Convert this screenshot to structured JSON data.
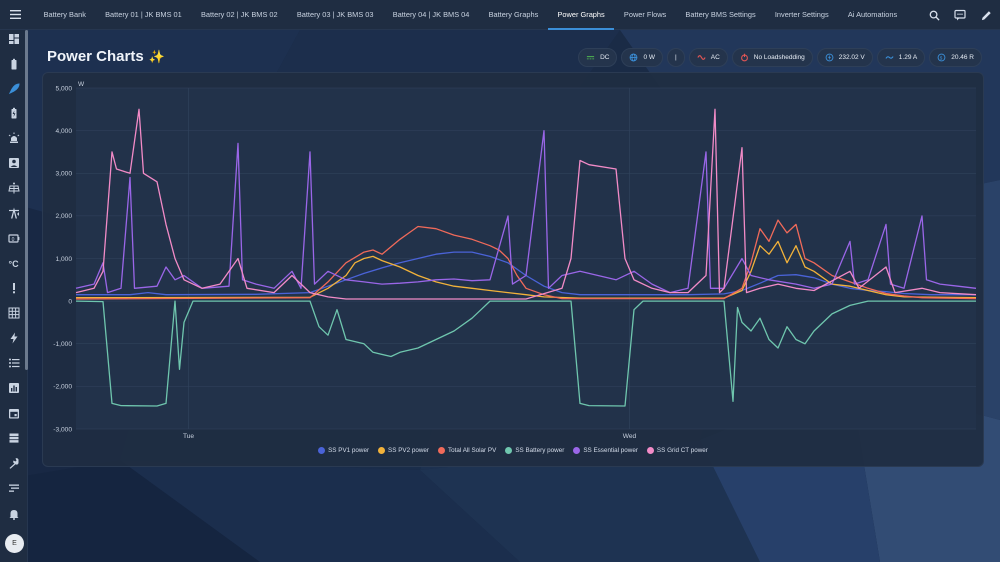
{
  "topbar": {
    "tabs": [
      {
        "label": "Battery Bank",
        "active": false
      },
      {
        "label": "Battery 01 | JK BMS 01",
        "active": false
      },
      {
        "label": "Battery 02 | JK BMS 02",
        "active": false
      },
      {
        "label": "Battery 03 | JK BMS 03",
        "active": false
      },
      {
        "label": "Battery 04 | JK BMS 04",
        "active": false
      },
      {
        "label": "Battery Graphs",
        "active": false
      },
      {
        "label": "Power Graphs",
        "active": true
      },
      {
        "label": "Power Flows",
        "active": false
      },
      {
        "label": "Battery BMS Settings",
        "active": false
      },
      {
        "label": "Inverter Settings",
        "active": false
      },
      {
        "label": "Ai Automations",
        "active": false
      }
    ],
    "icons": [
      "search-icon",
      "assist-icon",
      "edit-icon"
    ]
  },
  "sidebar": {
    "items": [
      "dashboard-icon",
      "battery-icon",
      "rocket-icon",
      "battery-charging-icon",
      "alarm-light-icon",
      "account-box-icon",
      "solar-panel-icon",
      "transmission-tower-icon",
      "battery-capacity-icon",
      "temperature-icon",
      "alert-icon",
      "grid-icon",
      "lightning-icon",
      "list-icon",
      "chart-icon",
      "calendar-icon",
      "server-icon",
      "wrench-icon",
      "settings-list-icon",
      "bell-icon"
    ],
    "active_index": 2,
    "avatar": "E"
  },
  "page": {
    "title": "Power Charts",
    "title_icon": "sparkles-icon"
  },
  "badges": [
    {
      "icon": "dc-icon",
      "label": "DC",
      "color": "#4caf50"
    },
    {
      "icon": "globe-icon",
      "label": "0 W",
      "color": "#3b8fd8"
    },
    {
      "icon": "divider",
      "label": "|",
      "color": "#e8eef6"
    },
    {
      "icon": "ac-icon",
      "label": "AC",
      "color": "#e05555"
    },
    {
      "icon": "power-plug-icon",
      "label": "No Loadshedding",
      "color": "#e05555"
    },
    {
      "icon": "voltage-icon",
      "label": "232.02 V",
      "color": "#3b8fd8"
    },
    {
      "icon": "current-icon",
      "label": "1.29 A",
      "color": "#3b8fd8"
    },
    {
      "icon": "currency-icon",
      "label": "20.46 R",
      "color": "#3b8fd8"
    }
  ],
  "chart_data": {
    "type": "line",
    "unit": "W",
    "ylim": [
      -3000,
      5000
    ],
    "yticks": [
      "5,000",
      "4,000",
      "3,000",
      "2,000",
      "1,000",
      "0",
      "-1,000",
      "-2,000",
      "-3,000"
    ],
    "xticks": [
      "Tue",
      "Wed"
    ],
    "grid": true,
    "legend_position": "bottom",
    "series": [
      {
        "name": "SS PV1 power",
        "color": "#4a63d8",
        "points": [
          [
            0,
            150
          ],
          [
            6,
            150
          ],
          [
            8,
            200
          ],
          [
            10,
            150
          ],
          [
            20,
            160
          ],
          [
            26,
            200
          ],
          [
            28,
            350
          ],
          [
            30,
            500
          ],
          [
            32,
            650
          ],
          [
            34,
            780
          ],
          [
            36,
            900
          ],
          [
            38,
            1000
          ],
          [
            40,
            1100
          ],
          [
            42,
            1150
          ],
          [
            44,
            1150
          ],
          [
            46,
            1050
          ],
          [
            48,
            900
          ],
          [
            50,
            600
          ],
          [
            52,
            350
          ],
          [
            54,
            200
          ],
          [
            56,
            150
          ],
          [
            68,
            150
          ],
          [
            72,
            170
          ],
          [
            74,
            250
          ],
          [
            76,
            420
          ],
          [
            78,
            600
          ],
          [
            80,
            620
          ],
          [
            82,
            550
          ],
          [
            84,
            400
          ],
          [
            86,
            300
          ],
          [
            88,
            250
          ],
          [
            90,
            220
          ],
          [
            92,
            180
          ],
          [
            95,
            150
          ],
          [
            100,
            150
          ]
        ]
      },
      {
        "name": "SS PV2 power",
        "color": "#f2b23a",
        "points": [
          [
            0,
            80
          ],
          [
            26,
            90
          ],
          [
            28,
            300
          ],
          [
            30,
            600
          ],
          [
            31,
            900
          ],
          [
            32,
            1000
          ],
          [
            33,
            1050
          ],
          [
            34,
            950
          ],
          [
            36,
            800
          ],
          [
            38,
            600
          ],
          [
            40,
            450
          ],
          [
            42,
            350
          ],
          [
            44,
            300
          ],
          [
            46,
            250
          ],
          [
            48,
            200
          ],
          [
            50,
            150
          ],
          [
            52,
            100
          ],
          [
            56,
            70
          ],
          [
            72,
            70
          ],
          [
            74,
            250
          ],
          [
            75,
            700
          ],
          [
            76,
            1300
          ],
          [
            77,
            1100
          ],
          [
            78,
            1400
          ],
          [
            79,
            900
          ],
          [
            80,
            1300
          ],
          [
            81,
            800
          ],
          [
            82,
            700
          ],
          [
            84,
            400
          ],
          [
            86,
            350
          ],
          [
            88,
            250
          ],
          [
            90,
            150
          ],
          [
            92,
            100
          ],
          [
            100,
            80
          ]
        ]
      },
      {
        "name": "Total All Solar PV",
        "color": "#f06a5a",
        "points": [
          [
            0,
            50
          ],
          [
            26,
            80
          ],
          [
            28,
            450
          ],
          [
            30,
            900
          ],
          [
            32,
            1150
          ],
          [
            33,
            1200
          ],
          [
            34,
            1100
          ],
          [
            36,
            1450
          ],
          [
            37,
            1600
          ],
          [
            38,
            1750
          ],
          [
            40,
            1700
          ],
          [
            42,
            1550
          ],
          [
            44,
            1450
          ],
          [
            46,
            1300
          ],
          [
            47,
            1200
          ],
          [
            48,
            1000
          ],
          [
            49,
            600
          ],
          [
            50,
            300
          ],
          [
            52,
            150
          ],
          [
            54,
            60
          ],
          [
            72,
            60
          ],
          [
            74,
            300
          ],
          [
            75,
            900
          ],
          [
            76,
            1700
          ],
          [
            77,
            1400
          ],
          [
            78,
            1900
          ],
          [
            79,
            1600
          ],
          [
            80,
            1800
          ],
          [
            81,
            1000
          ],
          [
            82,
            900
          ],
          [
            84,
            600
          ],
          [
            86,
            450
          ],
          [
            88,
            300
          ],
          [
            90,
            180
          ],
          [
            92,
            120
          ],
          [
            94,
            80
          ],
          [
            100,
            60
          ]
        ]
      },
      {
        "name": "SS Battery power",
        "color": "#6fc6ae",
        "points": [
          [
            0,
            0
          ],
          [
            3,
            -10
          ],
          [
            4,
            -2400
          ],
          [
            5,
            -2450
          ],
          [
            9,
            -2460
          ],
          [
            10,
            -2400
          ],
          [
            11,
            0
          ],
          [
            11.5,
            -1600
          ],
          [
            12,
            -500
          ],
          [
            13,
            0
          ],
          [
            26,
            0
          ],
          [
            27,
            -600
          ],
          [
            28,
            -800
          ],
          [
            29,
            -200
          ],
          [
            30,
            -900
          ],
          [
            32,
            -1000
          ],
          [
            33,
            -1200
          ],
          [
            35,
            -1300
          ],
          [
            36,
            -1200
          ],
          [
            38,
            -1100
          ],
          [
            40,
            -900
          ],
          [
            42,
            -700
          ],
          [
            44,
            -400
          ],
          [
            45,
            -200
          ],
          [
            46,
            0
          ],
          [
            55,
            0
          ],
          [
            56,
            -2400
          ],
          [
            57,
            -2450
          ],
          [
            61,
            -2460
          ],
          [
            62,
            -200
          ],
          [
            63,
            0
          ],
          [
            72,
            0
          ],
          [
            73,
            -2350
          ],
          [
            73.5,
            -150
          ],
          [
            74,
            -500
          ],
          [
            75,
            -700
          ],
          [
            76,
            -400
          ],
          [
            77,
            -900
          ],
          [
            78,
            -1100
          ],
          [
            79,
            -600
          ],
          [
            80,
            -900
          ],
          [
            81,
            -1000
          ],
          [
            82,
            -700
          ],
          [
            84,
            -300
          ],
          [
            86,
            -100
          ],
          [
            88,
            0
          ],
          [
            100,
            0
          ]
        ]
      },
      {
        "name": "SS Essential power",
        "color": "#9a66e8",
        "points": [
          [
            0,
            300
          ],
          [
            2,
            400
          ],
          [
            3,
            900
          ],
          [
            3.5,
            200
          ],
          [
            5,
            300
          ],
          [
            6,
            2900
          ],
          [
            6.5,
            300
          ],
          [
            9,
            350
          ],
          [
            10,
            800
          ],
          [
            11,
            500
          ],
          [
            12,
            600
          ],
          [
            14,
            300
          ],
          [
            17,
            350
          ],
          [
            18,
            3700
          ],
          [
            18.5,
            500
          ],
          [
            20,
            400
          ],
          [
            22,
            300
          ],
          [
            24,
            700
          ],
          [
            25,
            300
          ],
          [
            26,
            3500
          ],
          [
            26.5,
            400
          ],
          [
            28,
            700
          ],
          [
            30,
            500
          ],
          [
            32,
            450
          ],
          [
            34,
            400
          ],
          [
            36,
            420
          ],
          [
            38,
            450
          ],
          [
            40,
            500
          ],
          [
            42,
            520
          ],
          [
            44,
            480
          ],
          [
            46,
            500
          ],
          [
            48,
            2000
          ],
          [
            48.5,
            400
          ],
          [
            50,
            600
          ],
          [
            52,
            4000
          ],
          [
            52.5,
            300
          ],
          [
            54,
            600
          ],
          [
            56,
            700
          ],
          [
            58,
            600
          ],
          [
            60,
            500
          ],
          [
            62,
            700
          ],
          [
            64,
            400
          ],
          [
            66,
            200
          ],
          [
            68,
            300
          ],
          [
            70,
            3500
          ],
          [
            70.5,
            300
          ],
          [
            72,
            300
          ],
          [
            74,
            1000
          ],
          [
            75,
            600
          ],
          [
            77,
            500
          ],
          [
            80,
            400
          ],
          [
            82,
            300
          ],
          [
            84,
            400
          ],
          [
            86,
            1400
          ],
          [
            86.5,
            400
          ],
          [
            88,
            500
          ],
          [
            90,
            1800
          ],
          [
            90.5,
            400
          ],
          [
            92,
            300
          ],
          [
            94,
            2000
          ],
          [
            94.5,
            500
          ],
          [
            96,
            400
          ],
          [
            98,
            350
          ],
          [
            100,
            300
          ]
        ]
      },
      {
        "name": "SS Grid CT power",
        "color": "#f28bc7",
        "points": [
          [
            0,
            200
          ],
          [
            2,
            300
          ],
          [
            3,
            700
          ],
          [
            4,
            3500
          ],
          [
            4.5,
            3100
          ],
          [
            6,
            3000
          ],
          [
            7,
            4500
          ],
          [
            7.5,
            3000
          ],
          [
            9,
            2800
          ],
          [
            10,
            1800
          ],
          [
            11,
            1000
          ],
          [
            12,
            500
          ],
          [
            14,
            300
          ],
          [
            16,
            400
          ],
          [
            18,
            1000
          ],
          [
            19,
            300
          ],
          [
            22,
            200
          ],
          [
            24,
            600
          ],
          [
            26,
            200
          ],
          [
            28,
            100
          ],
          [
            30,
            50
          ],
          [
            40,
            50
          ],
          [
            50,
            50
          ],
          [
            54,
            300
          ],
          [
            55,
            1000
          ],
          [
            56,
            3300
          ],
          [
            57,
            3200
          ],
          [
            60,
            3100
          ],
          [
            61,
            1000
          ],
          [
            62,
            500
          ],
          [
            64,
            300
          ],
          [
            66,
            200
          ],
          [
            68,
            200
          ],
          [
            70,
            600
          ],
          [
            71,
            4500
          ],
          [
            71.5,
            200
          ],
          [
            72,
            300
          ],
          [
            74,
            3600
          ],
          [
            74.5,
            200
          ],
          [
            76,
            300
          ],
          [
            78,
            400
          ],
          [
            80,
            300
          ],
          [
            82,
            250
          ],
          [
            86,
            700
          ],
          [
            87,
            300
          ],
          [
            90,
            800
          ],
          [
            91,
            200
          ],
          [
            94,
            300
          ],
          [
            96,
            200
          ],
          [
            100,
            150
          ]
        ]
      }
    ]
  }
}
